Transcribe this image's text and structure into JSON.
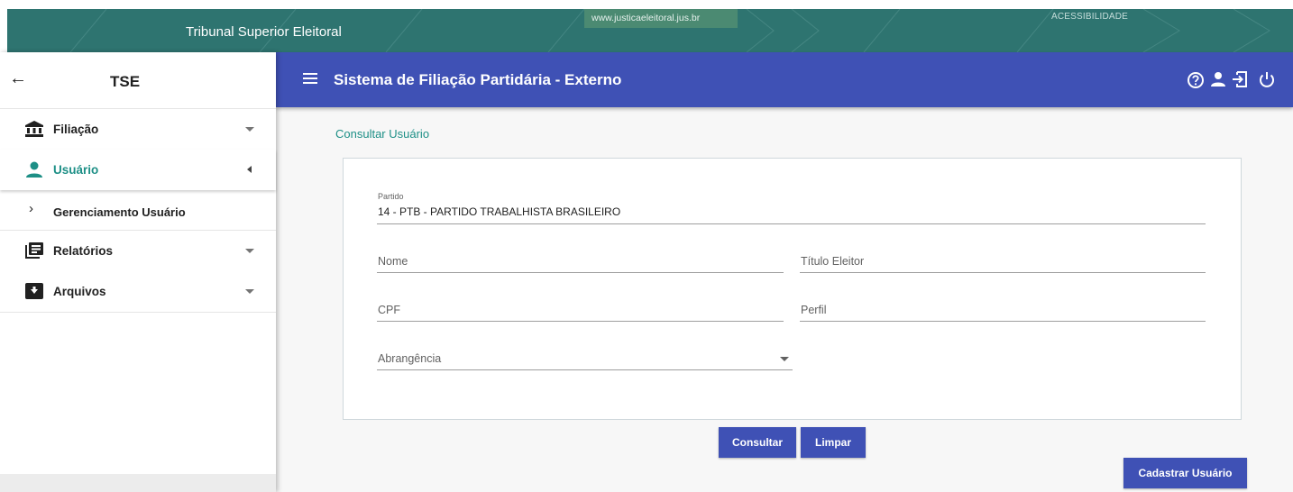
{
  "banner": {
    "title": "Tribunal Superior Eleitoral",
    "url": "www.justicaeleitoral.jus.br",
    "accessibility": "ACESSIBILIDADE"
  },
  "sidebar": {
    "brand": "TSE",
    "back_icon": "arrow-left-icon",
    "items": [
      {
        "label": "Filiação",
        "icon": "bank-icon",
        "caret": "caret-down",
        "active": false
      },
      {
        "label": "Usuário",
        "icon": "person-icon",
        "caret": "caret-left",
        "active": true
      },
      {
        "label": "Relatórios",
        "icon": "report-icon",
        "caret": "caret-down",
        "active": false
      },
      {
        "label": "Arquivos",
        "icon": "archive-icon",
        "caret": "caret-down",
        "active": false
      }
    ],
    "sub_item": {
      "label": "Gerenciamento Usuário",
      "icon": "chevron-right-icon"
    }
  },
  "header": {
    "title": "Sistema de Filiação Partidária - Externo",
    "icons": [
      "help-icon",
      "user-icon",
      "logout-icon",
      "power-icon"
    ]
  },
  "content": {
    "breadcrumb": "Consultar Usuário",
    "form": {
      "partido_label": "Partido",
      "partido_value": "14 - PTB - PARTIDO TRABALHISTA BRASILEIRO",
      "nome_placeholder": "Nome",
      "titulo_placeholder": "Título Eleitor",
      "cpf_placeholder": "CPF",
      "perfil_placeholder": "Perfil",
      "abrangencia_placeholder": "Abrangência"
    },
    "buttons": {
      "consultar": "Consultar",
      "limpar": "Limpar",
      "cadastrar": "Cadastrar Usuário"
    }
  },
  "colors": {
    "banner": "#2e7470",
    "primary": "#3f51b5",
    "accent": "#1d8f86"
  }
}
